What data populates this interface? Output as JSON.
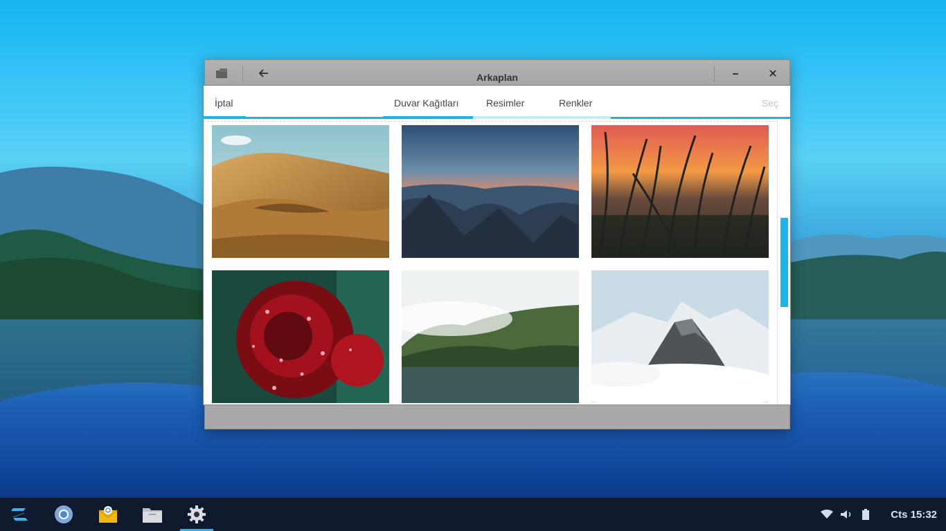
{
  "window": {
    "title": "Arkaplan"
  },
  "header": {
    "cancel_label": "İptal",
    "select_label": "Seç",
    "tabs": [
      {
        "label": "Duvar Kağıtları",
        "active": true
      },
      {
        "label": "Resimler",
        "active": false
      },
      {
        "label": "Renkler",
        "active": false
      }
    ]
  },
  "wallpapers": [
    {
      "subject": "desert-dunes"
    },
    {
      "subject": "mountain-sunset"
    },
    {
      "subject": "grass-sunset"
    },
    {
      "subject": "red-rose-droplets"
    },
    {
      "subject": "foggy-lake"
    },
    {
      "subject": "snowy-peaks-clouds"
    }
  ],
  "taskbar": {
    "apps": [
      {
        "icon": "zorin-logo-icon"
      },
      {
        "icon": "chromium-browser-icon"
      },
      {
        "icon": "mail-client-icon"
      },
      {
        "icon": "files-folder-icon"
      },
      {
        "icon": "settings-gear-icon",
        "active": true
      }
    ],
    "tray": [
      "wifi-icon",
      "volume-icon",
      "battery-icon"
    ],
    "clock": "Cts 15:32"
  },
  "colors": {
    "accent": "#19b2ea",
    "taskbar_bg": "#0f1a2e",
    "window_chrome": "#a9a9a9"
  }
}
